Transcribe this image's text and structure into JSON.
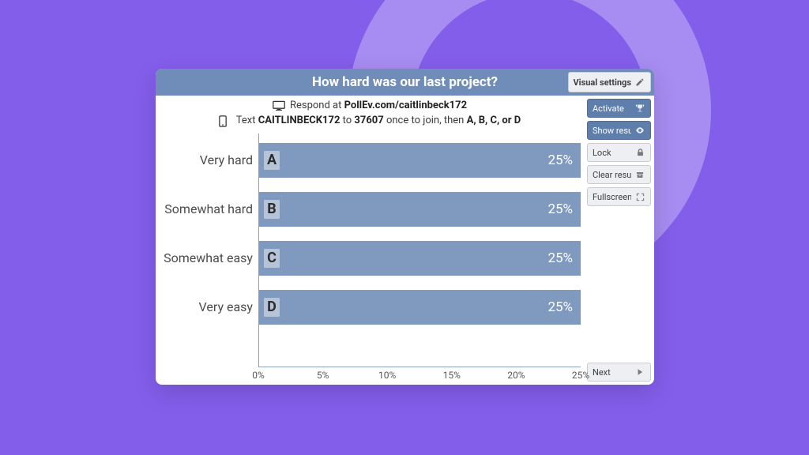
{
  "title": "How hard was our last project?",
  "instructions": {
    "respond_prefix": "Respond at ",
    "respond_url_bold": "PollEv.com/caitlinbeck172",
    "text_prefix": "Text ",
    "text_code_bold": "CAITLINBECK172",
    "text_mid1": " to ",
    "text_number_bold": "37607",
    "text_mid2": " once to join, then ",
    "text_options_bold": "A, B, C, or D"
  },
  "sidebar": {
    "visual_settings": "Visual settings",
    "activate": "Activate",
    "show_results": "Show results",
    "lock": "Lock",
    "clear_results": "Clear results",
    "fullscreen": "Fullscreen",
    "next": "Next"
  },
  "axis": {
    "ticks": [
      "0%",
      "5%",
      "10%",
      "15%",
      "20%",
      "25%"
    ]
  },
  "chart_data": {
    "type": "bar",
    "orientation": "horizontal",
    "title": "How hard was our last project?",
    "xlabel": "",
    "ylabel": "",
    "xlim": [
      0,
      25
    ],
    "categories": [
      "Very hard",
      "Somewhat hard",
      "Somewhat easy",
      "Very easy"
    ],
    "letters": [
      "A",
      "B",
      "C",
      "D"
    ],
    "values": [
      25,
      25,
      25,
      25
    ],
    "value_labels": [
      "25%",
      "25%",
      "25%",
      "25%"
    ]
  }
}
